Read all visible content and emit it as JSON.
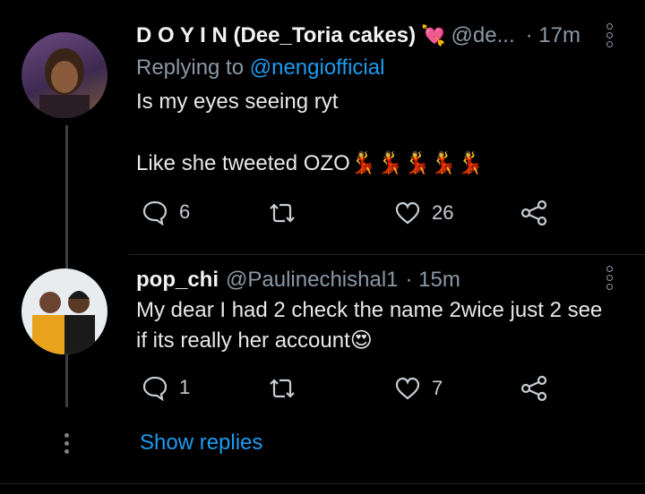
{
  "tweets": [
    {
      "display_name": "D O Y I N (Dee_Toria cakes)",
      "name_emoji": "💘",
      "handle": "@de...",
      "time": "· 17m",
      "replying_prefix": "Replying to ",
      "replying_to": "@nengiofficial",
      "text_line1": "Is my eyes seeing ryt",
      "text_line2": "Like she tweeted OZO💃💃💃💃💃",
      "replies": "6",
      "retweets": "",
      "likes": "26"
    },
    {
      "display_name": "pop_chi",
      "handle": "@Paulinechishal1",
      "time": "· 15m",
      "text_line1": "My dear I had 2 check the name 2wice just 2 see",
      "text_line2": "if its really her account😍",
      "replies": "1",
      "retweets": "",
      "likes": "7"
    }
  ],
  "show_replies_label": "Show replies",
  "colors": {
    "accent": "#1d9bf0",
    "muted": "#8b98a5",
    "background": "#000000"
  }
}
